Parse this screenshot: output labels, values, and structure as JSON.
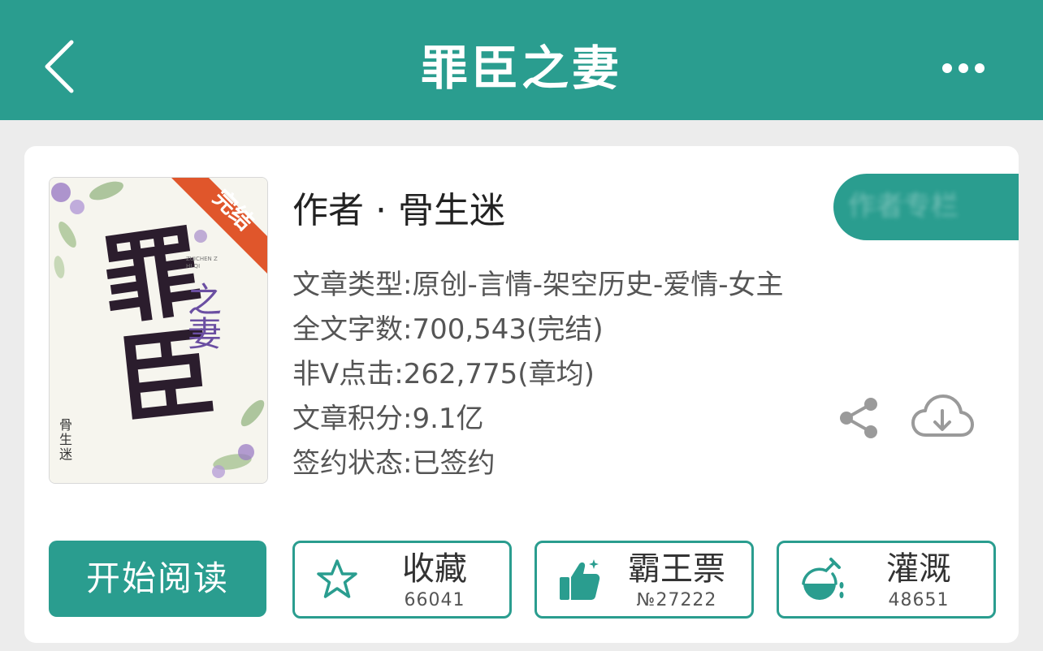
{
  "header": {
    "title": "罪臣之妻"
  },
  "book": {
    "cover": {
      "badge": "完结",
      "title_chars": [
        "罪",
        "臣"
      ],
      "subtitle_chars": [
        "之",
        "妻"
      ],
      "author_vertical": "骨生迷",
      "pinyin": "ZUICHEN ZHI QI"
    },
    "author_line": "作者 · 骨生迷",
    "meta": [
      "文章类型:原创-言情-架空历史-爱情-女主",
      "全文字数:700,543(完结)",
      "非V点击:262,775(章均)",
      "文章积分:9.1亿",
      "签约状态:已签约"
    ],
    "pill_text": "作者专栏"
  },
  "actions": {
    "start_label": "开始阅读",
    "favorite": {
      "label": "收藏",
      "count": "66041"
    },
    "vote": {
      "label": "霸王票",
      "count": "№27222"
    },
    "nutrient": {
      "label": "灌溉",
      "count": "48651"
    }
  },
  "colors": {
    "accent": "#2a9d8f",
    "badge": "#e0562b",
    "icon_gray": "#9a9a9a"
  }
}
